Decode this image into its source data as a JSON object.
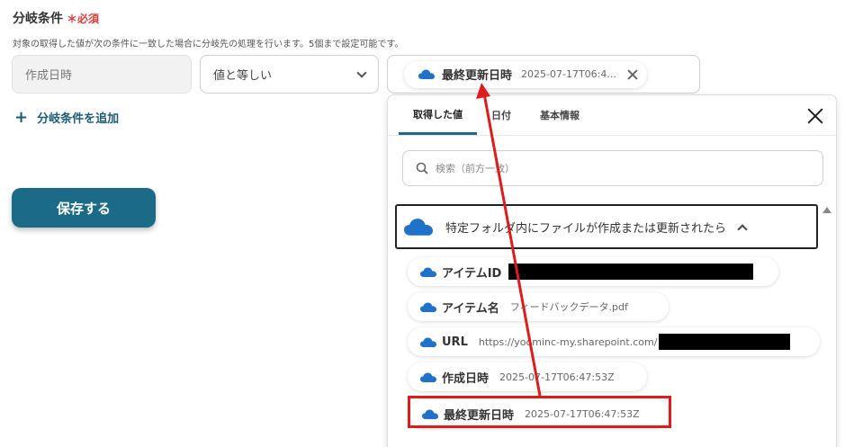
{
  "section": {
    "title": "分岐条件",
    "required_mark": "＊必須",
    "description": "対象の取得した値が次の条件に一致した場合に分岐先の処理を行います。5個まで設定可能です。"
  },
  "condition": {
    "field_value": "作成日時",
    "operator_value": "値と等しい",
    "selected_chip": {
      "label": "最終更新日時",
      "value": "2025-07-17T06:4..."
    }
  },
  "add_condition_label": "分岐条件を追加",
  "save_label": "保存する",
  "picker": {
    "tabs": [
      "取得した値",
      "日付",
      "基本情報"
    ],
    "search_placeholder": "検索（前方一致）",
    "group_label": "特定フォルダ内にファイルが作成または更新されたら",
    "items": [
      {
        "label": "アイテムID",
        "value": ""
      },
      {
        "label": "アイテム名",
        "value": "フィードバックデータ.pdf"
      },
      {
        "label": "URL",
        "value": "https://yoominc-my.sharepoint.com/"
      },
      {
        "label": "作成日時",
        "value": "2025-07-17T06:47:53Z"
      },
      {
        "label": "最終更新日時",
        "value": "2025-07-17T06:47:53Z"
      }
    ]
  },
  "colors": {
    "accent": "#1b6b88",
    "required": "#e53935",
    "highlight": "#e01b1b",
    "onedrive": "#1e73c8"
  }
}
